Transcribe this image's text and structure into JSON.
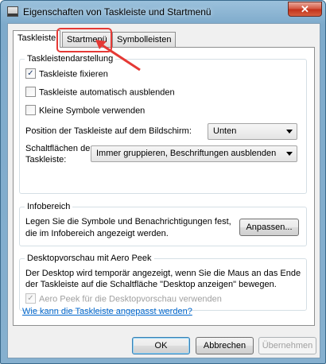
{
  "window": {
    "title": "Eigenschaften von Taskleiste und Startmenü",
    "close_glyph": "✕"
  },
  "tabs": [
    {
      "label": "Taskleiste",
      "active": true
    },
    {
      "label": "Startmenü",
      "active": false
    },
    {
      "label": "Symbolleisten",
      "active": false
    }
  ],
  "taskbar_group": {
    "title": "Taskleistendarstellung",
    "checkboxes": [
      {
        "label": "Taskleiste fixieren",
        "checked": true
      },
      {
        "label": "Taskleiste automatisch ausblenden",
        "checked": false
      },
      {
        "label": "Kleine Symbole verwenden",
        "checked": false
      }
    ],
    "position_label": "Position der Taskleiste auf dem Bildschirm:",
    "position_value": "Unten",
    "buttons_label_line1": "Schaltflächen der",
    "buttons_label_line2": "Taskleiste:",
    "buttons_value": "Immer gruppieren, Beschriftungen ausblenden"
  },
  "notification_group": {
    "title": "Infobereich",
    "text_line1": "Legen Sie die Symbole und Benachrichtigungen fest,",
    "text_line2": "die im Infobereich angezeigt werden.",
    "button_label": "Anpassen..."
  },
  "aero_group": {
    "title": "Desktopvorschau mit Aero Peek",
    "text_line1": "Der Desktop wird temporär angezeigt, wenn Sie die Maus an das Ende",
    "text_line2": "der Taskleiste auf die Schaltfläche \"Desktop anzeigen\" bewegen.",
    "checkbox_label": "Aero Peek für die Desktopvorschau verwenden",
    "checkbox_checked": true,
    "checkbox_disabled": true
  },
  "help_link": "Wie kann die Taskleiste angepasst werden?",
  "footer": {
    "ok": "OK",
    "cancel": "Abbrechen",
    "apply": "Übernehmen"
  },
  "colors": {
    "highlight": "#e53935",
    "link": "#0066cc"
  }
}
